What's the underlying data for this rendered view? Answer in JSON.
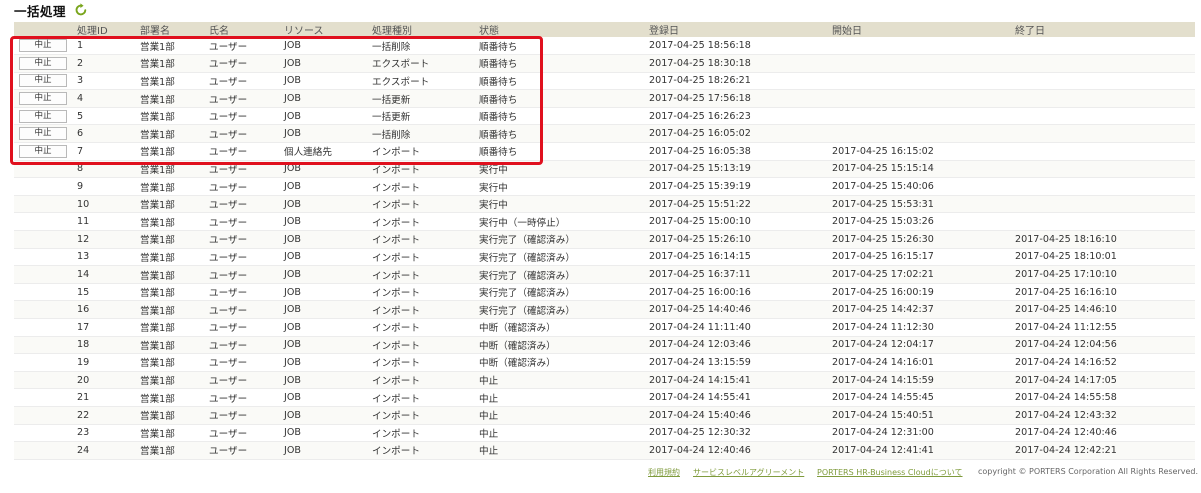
{
  "page": {
    "title": "一括処理",
    "refresh_icon": "refresh-icon",
    "accent_color": "#79a51c",
    "highlight_color": "#e0101e"
  },
  "table": {
    "columns": [
      "処理ID",
      "部署名",
      "氏名",
      "リソース",
      "処理種別",
      "状態",
      "登録日",
      "開始日",
      "終了日"
    ],
    "abort_label": "中止",
    "rows": [
      {
        "id": "1",
        "dept": "営業1部",
        "name": "ユーザー",
        "resource": "JOB",
        "type": "一括削除",
        "status": "順番待ち",
        "registered": "2017-04-25 18:56:18",
        "started": "",
        "ended": "",
        "abortable": true
      },
      {
        "id": "2",
        "dept": "営業1部",
        "name": "ユーザー",
        "resource": "JOB",
        "type": "エクスポート",
        "status": "順番待ち",
        "registered": "2017-04-25 18:30:18",
        "started": "",
        "ended": "",
        "abortable": true
      },
      {
        "id": "3",
        "dept": "営業1部",
        "name": "ユーザー",
        "resource": "JOB",
        "type": "エクスポート",
        "status": "順番待ち",
        "registered": "2017-04-25 18:26:21",
        "started": "",
        "ended": "",
        "abortable": true
      },
      {
        "id": "4",
        "dept": "営業1部",
        "name": "ユーザー",
        "resource": "JOB",
        "type": "一括更新",
        "status": "順番待ち",
        "registered": "2017-04-25 17:56:18",
        "started": "",
        "ended": "",
        "abortable": true
      },
      {
        "id": "5",
        "dept": "営業1部",
        "name": "ユーザー",
        "resource": "JOB",
        "type": "一括更新",
        "status": "順番待ち",
        "registered": "2017-04-25 16:26:23",
        "started": "",
        "ended": "",
        "abortable": true
      },
      {
        "id": "6",
        "dept": "営業1部",
        "name": "ユーザー",
        "resource": "JOB",
        "type": "一括削除",
        "status": "順番待ち",
        "registered": "2017-04-25 16:05:02",
        "started": "",
        "ended": "",
        "abortable": true
      },
      {
        "id": "7",
        "dept": "営業1部",
        "name": "ユーザー",
        "resource": "個人連絡先",
        "type": "インポート",
        "status": "順番待ち",
        "registered": "2017-04-25 16:05:38",
        "started": "2017-04-25 16:15:02",
        "ended": "",
        "abortable": true
      },
      {
        "id": "8",
        "dept": "営業1部",
        "name": "ユーザー",
        "resource": "JOB",
        "type": "インポート",
        "status": "実行中",
        "registered": "2017-04-25 15:13:19",
        "started": "2017-04-25 15:15:14",
        "ended": "",
        "abortable": false
      },
      {
        "id": "9",
        "dept": "営業1部",
        "name": "ユーザー",
        "resource": "JOB",
        "type": "インポート",
        "status": "実行中",
        "registered": "2017-04-25 15:39:19",
        "started": "2017-04-25 15:40:06",
        "ended": "",
        "abortable": false
      },
      {
        "id": "10",
        "dept": "営業1部",
        "name": "ユーザー",
        "resource": "JOB",
        "type": "インポート",
        "status": "実行中",
        "registered": "2017-04-25 15:51:22",
        "started": "2017-04-25 15:53:31",
        "ended": "",
        "abortable": false
      },
      {
        "id": "11",
        "dept": "営業1部",
        "name": "ユーザー",
        "resource": "JOB",
        "type": "インポート",
        "status": "実行中（一時停止）",
        "registered": "2017-04-25 15:00:10",
        "started": "2017-04-25 15:03:26",
        "ended": "",
        "abortable": false
      },
      {
        "id": "12",
        "dept": "営業1部",
        "name": "ユーザー",
        "resource": "JOB",
        "type": "インポート",
        "status": "実行完了（確認済み）",
        "registered": "2017-04-25 15:26:10",
        "started": "2017-04-25 15:26:30",
        "ended": "2017-04-25 18:16:10",
        "abortable": false
      },
      {
        "id": "13",
        "dept": "営業1部",
        "name": "ユーザー",
        "resource": "JOB",
        "type": "インポート",
        "status": "実行完了（確認済み）",
        "registered": "2017-04-25 16:14:15",
        "started": "2017-04-25 16:15:17",
        "ended": "2017-04-25 18:10:01",
        "abortable": false
      },
      {
        "id": "14",
        "dept": "営業1部",
        "name": "ユーザー",
        "resource": "JOB",
        "type": "インポート",
        "status": "実行完了（確認済み）",
        "registered": "2017-04-25 16:37:11",
        "started": "2017-04-25 17:02:21",
        "ended": "2017-04-25 17:10:10",
        "abortable": false
      },
      {
        "id": "15",
        "dept": "営業1部",
        "name": "ユーザー",
        "resource": "JOB",
        "type": "インポート",
        "status": "実行完了（確認済み）",
        "registered": "2017-04-25 16:00:16",
        "started": "2017-04-25 16:00:19",
        "ended": "2017-04-25 16:16:10",
        "abortable": false
      },
      {
        "id": "16",
        "dept": "営業1部",
        "name": "ユーザー",
        "resource": "JOB",
        "type": "インポート",
        "status": "実行完了（確認済み）",
        "registered": "2017-04-25 14:40:46",
        "started": "2017-04-25 14:42:37",
        "ended": "2017-04-25 14:46:10",
        "abortable": false
      },
      {
        "id": "17",
        "dept": "営業1部",
        "name": "ユーザー",
        "resource": "JOB",
        "type": "インポート",
        "status": "中断（確認済み）",
        "registered": "2017-04-24 11:11:40",
        "started": "2017-04-24 11:12:30",
        "ended": "2017-04-24 11:12:55",
        "abortable": false
      },
      {
        "id": "18",
        "dept": "営業1部",
        "name": "ユーザー",
        "resource": "JOB",
        "type": "インポート",
        "status": "中断（確認済み）",
        "registered": "2017-04-24 12:03:46",
        "started": "2017-04-24 12:04:17",
        "ended": "2017-04-24 12:04:56",
        "abortable": false
      },
      {
        "id": "19",
        "dept": "営業1部",
        "name": "ユーザー",
        "resource": "JOB",
        "type": "インポート",
        "status": "中断（確認済み）",
        "registered": "2017-04-24 13:15:59",
        "started": "2017-04-24 14:16:01",
        "ended": "2017-04-24 14:16:52",
        "abortable": false
      },
      {
        "id": "20",
        "dept": "営業1部",
        "name": "ユーザー",
        "resource": "JOB",
        "type": "インポート",
        "status": "中止",
        "registered": "2017-04-24 14:15:41",
        "started": "2017-04-24 14:15:59",
        "ended": "2017-04-24 14:17:05",
        "abortable": false
      },
      {
        "id": "21",
        "dept": "営業1部",
        "name": "ユーザー",
        "resource": "JOB",
        "type": "インポート",
        "status": "中止",
        "registered": "2017-04-24 14:55:41",
        "started": "2017-04-24 14:55:45",
        "ended": "2017-04-24 14:55:58",
        "abortable": false
      },
      {
        "id": "22",
        "dept": "営業1部",
        "name": "ユーザー",
        "resource": "JOB",
        "type": "インポート",
        "status": "中止",
        "registered": "2017-04-24 15:40:46",
        "started": "2017-04-24 15:40:51",
        "ended": "2017-04-24 12:43:32",
        "abortable": false
      },
      {
        "id": "23",
        "dept": "営業1部",
        "name": "ユーザー",
        "resource": "JOB",
        "type": "インポート",
        "status": "中止",
        "registered": "2017-04-25 12:30:32",
        "started": "2017-04-24 12:31:00",
        "ended": "2017-04-24 12:40:46",
        "abortable": false
      },
      {
        "id": "24",
        "dept": "営業1部",
        "name": "ユーザー",
        "resource": "JOB",
        "type": "インポート",
        "status": "中止",
        "registered": "2017-04-24 12:40:46",
        "started": "2017-04-24 12:41:41",
        "ended": "2017-04-24 12:42:21",
        "abortable": false
      }
    ]
  },
  "footer": {
    "links": [
      "利用規約",
      "サービスレベルアグリーメント",
      "PORTERS HR-Business Cloudについて"
    ],
    "copyright": "copyright © PORTERS Corporation All Rights Reserved."
  }
}
